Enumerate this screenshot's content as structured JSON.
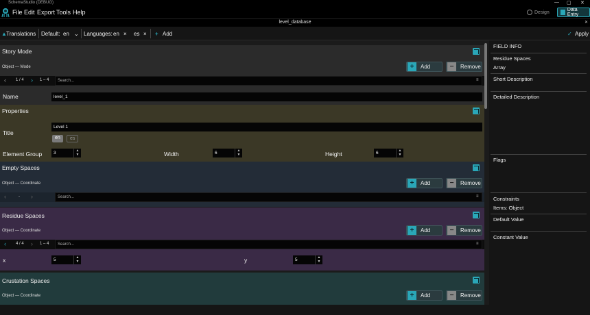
{
  "window": {
    "title": "SchemaStudio (DEBUG)",
    "min": "—",
    "max": "▢",
    "close": "✕"
  },
  "menu": [
    "File",
    "Edit",
    "Export",
    "Tools",
    "Help"
  ],
  "modes": {
    "design": "Design",
    "data_entry": "Data Entry"
  },
  "document": {
    "title": "level_database",
    "close": "✕"
  },
  "toolbar": {
    "translations": "Translations",
    "default_label": "Default:",
    "default_value": "en",
    "languages_label": "Languages:",
    "lang1": "en",
    "lang2": "es",
    "remove": "×",
    "add": "Add",
    "apply": "Apply"
  },
  "buttons": {
    "add": "Add",
    "remove": "Remove"
  },
  "story_mode": {
    "title": "Story Mode",
    "subtitle": "Object — Mode",
    "page": "1 / 4",
    "range": "1 – 4",
    "search_placeholder": "Search...",
    "name_label": "Name",
    "name_value": "level_1"
  },
  "properties": {
    "title": "Properties",
    "title_label": "Title",
    "title_value": "Level 1",
    "lang_en": "en",
    "lang_es": "es",
    "element_group_label": "Element Group",
    "element_group_value": "3",
    "width_label": "Width",
    "width_value": "6",
    "height_label": "Height",
    "height_value": "6"
  },
  "empty_spaces": {
    "title": "Empty Spaces",
    "subtitle": "Object — Coordinate",
    "page": "-",
    "search_placeholder": "Search..."
  },
  "residue_spaces": {
    "title": "Residue Spaces",
    "subtitle": "Object — Coordinate",
    "page": "4 / 4",
    "range": "1 – 4",
    "search_placeholder": "Search...",
    "x_label": "x",
    "x_value": "5",
    "y_label": "y",
    "y_value": "5"
  },
  "crustation_spaces": {
    "title": "Crustation Spaces",
    "subtitle": "Object — Coordinate"
  },
  "field_info": {
    "header": "FIELD INFO",
    "field_name": "Residue Spaces",
    "field_type": "Array",
    "short_desc": "Short Description",
    "detailed_desc": "Detailed Description",
    "flags": "Flags",
    "constraints": "Constraints",
    "items": "Items: Object",
    "default_value": "Default Value",
    "constant_value": "Constant Value"
  },
  "colors": {
    "accent": "#2aa7b8",
    "story_bg": "#2b2b2b",
    "properties_bg": "#3b3826",
    "empty_bg": "#232c37",
    "residue_bg": "#3a2a46",
    "crustation_bg": "#213b3c"
  }
}
